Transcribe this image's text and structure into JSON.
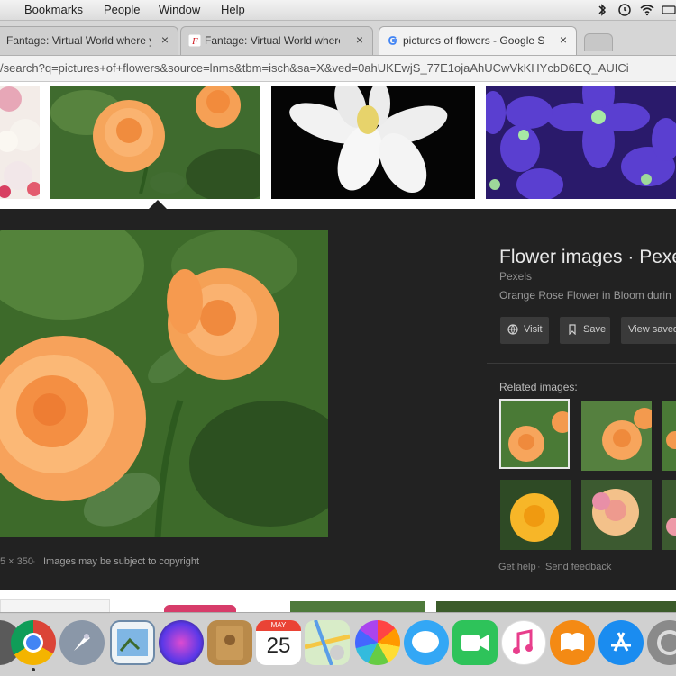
{
  "menubar": {
    "items": [
      "Bookmarks",
      "People",
      "Window",
      "Help"
    ]
  },
  "tabs": [
    {
      "title": "Fantage: Virtual World where y",
      "close": "×"
    },
    {
      "title": "Fantage: Virtual World where y",
      "close": "×"
    },
    {
      "title": "pictures of flowers - Google S",
      "close": "×"
    }
  ],
  "address": {
    "url": "/search?q=pictures+of+flowers&source=lnms&tbm=isch&sa=X&ved=0ahUKEwjS_77E1ojaAhUCwVkKHYcbD6EQ_AUICi"
  },
  "preview": {
    "title": "Flower images · Pexe",
    "source": "Pexels",
    "description": "Orange Rose Flower in Bloom durin",
    "visit_label": "Visit",
    "save_label": "Save",
    "view_saved_label": "View saved",
    "related_label": "Related images:",
    "dimensions": "5 × 350",
    "copyright": "Images may be subject to copyright",
    "get_help": "Get help",
    "separator": "·",
    "send_feedback": "Send feedback"
  },
  "dock": {
    "calendar_month": "MAY",
    "calendar_day": "25"
  },
  "colors": {
    "panel": "#222222",
    "rose": "#f6a35a",
    "purple": "#4a2fb8"
  }
}
